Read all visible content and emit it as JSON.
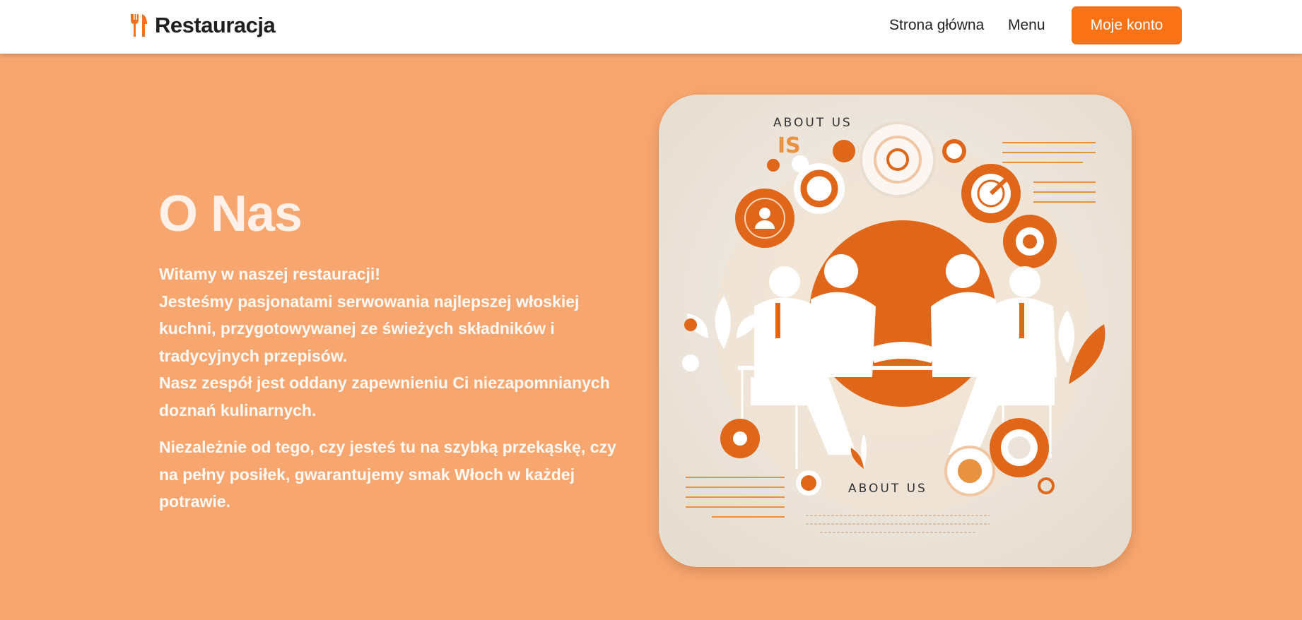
{
  "brand": {
    "name": "Restauracja",
    "icon": "fork-knife-icon"
  },
  "nav": {
    "home_label": "Strona główna",
    "menu_label": "Menu",
    "account_label": "Moje konto"
  },
  "about": {
    "title": "O Nas",
    "lines": [
      "Witamy w naszej restauracji!",
      "Jesteśmy pasjonatami serwowania najlepszej włoskiej kuchni, przygotowywanej ze świeżych składników i tradycyjnych przepisów.",
      "Nasz zespół jest oddany zapewnieniu Ci niezapomnianych doznań kulinarnych."
    ],
    "paragraph2": "Niezależnie od tego, czy jesteś tu na szybką przekąskę, czy na pełny posiłek, gwarantujemy smak Włoch w każdej potrawie."
  },
  "image": {
    "top_caption": "ABOUT US",
    "bottom_caption": "ABOUT US"
  },
  "colors": {
    "background": "#f8a66f",
    "accent": "#f97316",
    "navbar": "#ffffff",
    "illustration_orange": "#e0661a"
  }
}
